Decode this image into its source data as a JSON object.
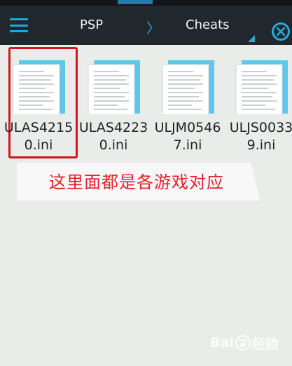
{
  "toolbar": {
    "path": [
      "PSP",
      "Cheats"
    ],
    "separator": "〉"
  },
  "files": [
    {
      "name": "ULAS42150.ini",
      "selected": true
    },
    {
      "name": "ULAS42230.ini",
      "selected": false
    },
    {
      "name": "ULJM05467.ini",
      "selected": false
    },
    {
      "name": "ULJS00339.ini",
      "selected": false
    }
  ],
  "annotation": {
    "text": "这里面都是各游戏对应",
    "color": "#e3202a"
  },
  "watermark": {
    "left": "Bai",
    "right": "经验"
  },
  "colors": {
    "accent": "#28a8dc",
    "toolbar": "#20282d",
    "background": "#e9ece9",
    "selection": "#d4141e"
  }
}
